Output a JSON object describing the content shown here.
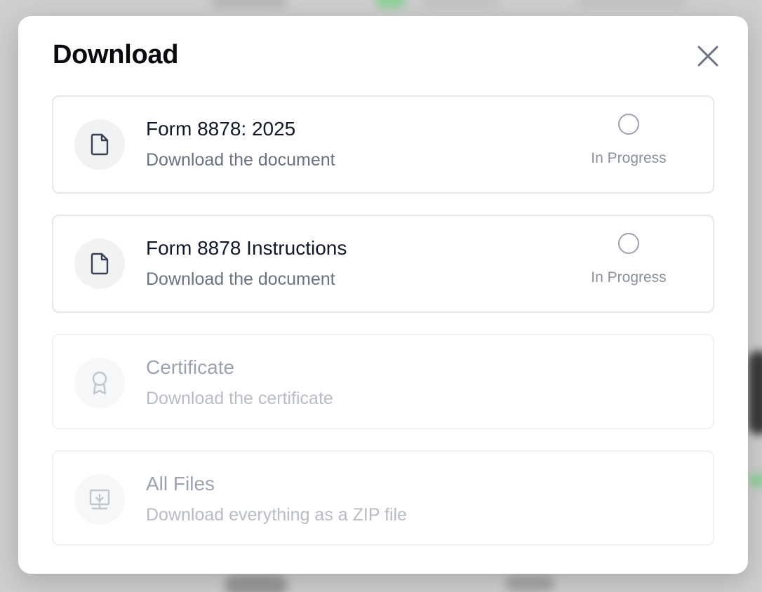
{
  "modal": {
    "title": "Download",
    "close_label": "×"
  },
  "items": [
    {
      "title": "Form 8878: 2025",
      "subtitle": "Download the document",
      "icon": "document-icon",
      "status": "In Progress",
      "enabled": true
    },
    {
      "title": "Form 8878 Instructions",
      "subtitle": "Download the document",
      "icon": "document-icon",
      "status": "In Progress",
      "enabled": true
    },
    {
      "title": "Certificate",
      "subtitle": "Download the certificate",
      "icon": "award-ribbon-icon",
      "enabled": false
    },
    {
      "title": "All Files",
      "subtitle": "Download everything as a ZIP file",
      "icon": "archive-icon",
      "enabled": false
    }
  ],
  "colors": {
    "text_primary": "#111827",
    "text_secondary": "#6b7280",
    "border": "#e5e7eb",
    "disabled_text": "#9ca3af"
  }
}
